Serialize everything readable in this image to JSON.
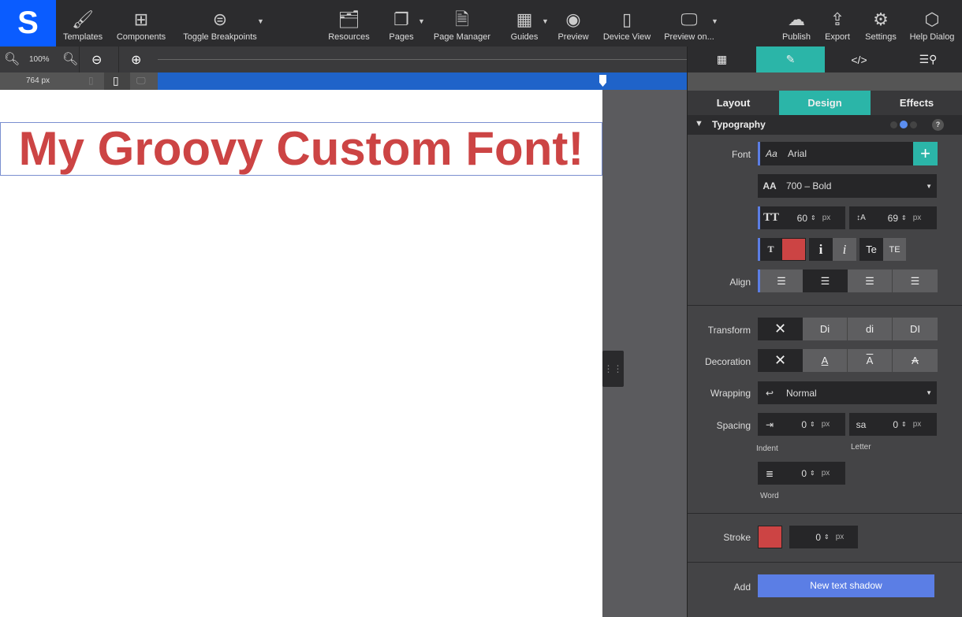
{
  "toolbar": {
    "logo": "S",
    "items": [
      {
        "label": "Templates",
        "icon": "paint-roller-icon"
      },
      {
        "label": "Components",
        "icon": "puzzle-icon"
      },
      {
        "label": "Toggle Breakpoints",
        "icon": "toggle-icon"
      },
      {
        "label": "Resources",
        "icon": "folders-icon"
      },
      {
        "label": "Pages",
        "icon": "pages-icon"
      },
      {
        "label": "Page Manager",
        "icon": "page-manager-icon"
      },
      {
        "label": "Guides",
        "icon": "grid-icon"
      },
      {
        "label": "Preview",
        "icon": "eye-icon"
      },
      {
        "label": "Device View",
        "icon": "devices-icon"
      },
      {
        "label": "Preview on...",
        "icon": "monitor-icon"
      },
      {
        "label": "Publish",
        "icon": "cloud-upload-icon"
      },
      {
        "label": "Export",
        "icon": "export-icon"
      },
      {
        "label": "Settings",
        "icon": "gear-icon"
      },
      {
        "label": "Help Dialog",
        "icon": "help-icon"
      }
    ]
  },
  "zoom": {
    "level": "100%",
    "width": "764 px"
  },
  "canvas": {
    "headline": "My Groovy Custom Font!",
    "headline_color": "#cc4444"
  },
  "panel": {
    "subtabs": [
      "Layout",
      "Design",
      "Effects"
    ],
    "section": "Typography",
    "font_label": "Font",
    "font": "Arial",
    "weight": "700 – Bold",
    "size": "60",
    "line_height": "69",
    "unit": "px",
    "text_color": "#cc4444",
    "align_label": "Align",
    "transform_label": "Transform",
    "transform_opts": [
      "✕",
      "Di",
      "di",
      "DI"
    ],
    "decoration_label": "Decoration",
    "wrapping_label": "Wrapping",
    "wrapping": "Normal",
    "spacing_label": "Spacing",
    "indent": "0",
    "indent_label": "Indent",
    "letter": "0",
    "letter_label": "Letter",
    "word": "0",
    "word_label": "Word",
    "stroke_label": "Stroke",
    "stroke": "0",
    "stroke_color": "#cc4444",
    "add_label": "Add",
    "shadow_btn": "New text shadow"
  },
  "colors": {
    "accent": "#2bb5a8",
    "brand": "#0a5cff",
    "blue": "#1f63c9"
  }
}
